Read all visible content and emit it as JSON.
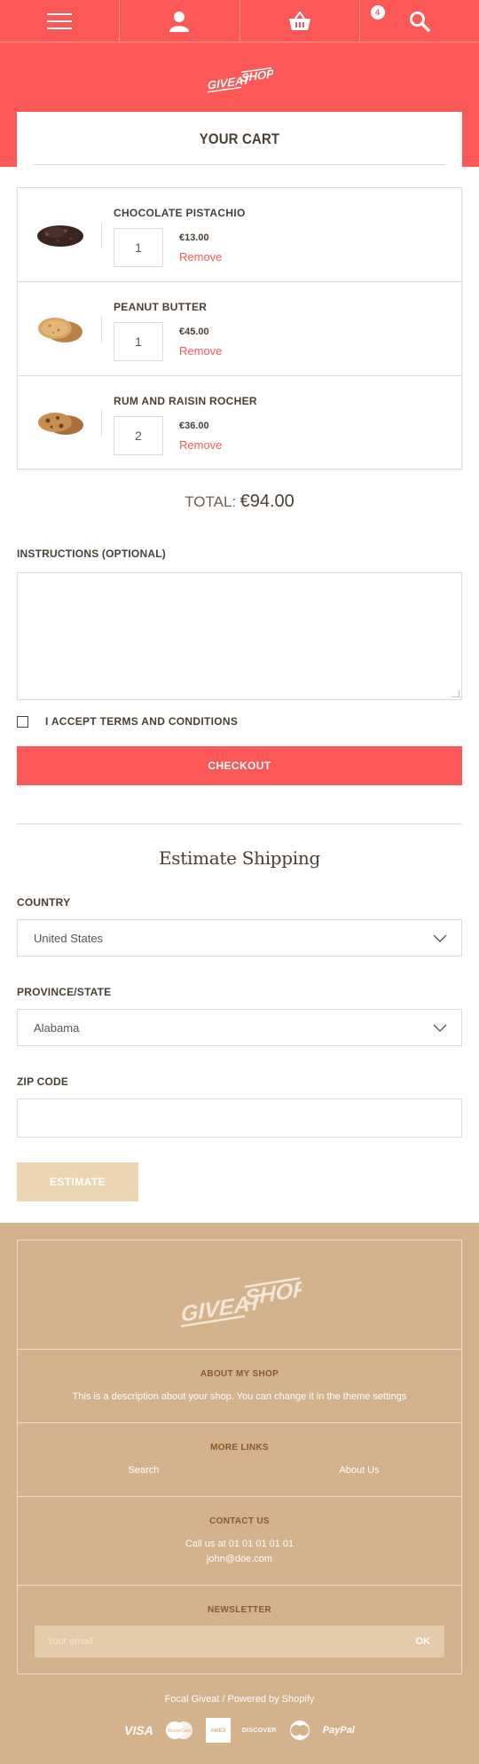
{
  "header": {
    "cart_count": "4",
    "icons": [
      "menu-icon",
      "user-icon",
      "basket-icon",
      "search-icon"
    ]
  },
  "brand": {
    "logo_text": "GIVEAT SHOP"
  },
  "cart": {
    "title": "YOUR CART",
    "items": [
      {
        "name": "CHOCOLATE PISTACHIO",
        "quantity": "1",
        "price": "€13.00",
        "remove": "Remove"
      },
      {
        "name": "PEANUT BUTTER",
        "quantity": "1",
        "price": "€45.00",
        "remove": "Remove"
      },
      {
        "name": "RUM AND RAISIN ROCHER",
        "quantity": "2",
        "price": "€36.00",
        "remove": "Remove"
      }
    ],
    "total_label": "TOTAL:",
    "total_value": "€94.00"
  },
  "instructions": {
    "label": "INSTRUCTIONS (OPTIONAL)",
    "value": ""
  },
  "terms": {
    "label": "I ACCEPT TERMS AND CONDITIONS",
    "checked": false
  },
  "checkout_label": "CHECKOUT",
  "shipping": {
    "title": "Estimate Shipping",
    "country_label": "COUNTRY",
    "country_value": "United States",
    "province_label": "PROVINCE/STATE",
    "province_value": "Alabama",
    "zip_label": "ZIP CODE",
    "zip_value": "",
    "estimate_label": "ESTIMATE"
  },
  "footer": {
    "about_title": "ABOUT MY SHOP",
    "about_text": "This is a description about your shop. You can change it in the theme settings",
    "links_title": "MORE LINKS",
    "links": [
      "Search",
      "About Us"
    ],
    "contact_title": "CONTACT US",
    "contact_phone": "Call us at 01 01 01 01 01",
    "contact_email": "john@doe.com",
    "newsletter_title": "NEWSLETTER",
    "newsletter_placeholder": "Your email",
    "newsletter_button": "OK",
    "powered": "Focal Giveat / Powered by Shopify",
    "payments": [
      "VISA",
      "MasterCard",
      "AMEX",
      "DISCOVER",
      "Diners",
      "PayPal"
    ]
  },
  "colors": {
    "accent": "#fc5857",
    "footer_bg": "#d3b28c",
    "text": "#4a3f35",
    "estimate_bg": "#ebd5b3"
  }
}
